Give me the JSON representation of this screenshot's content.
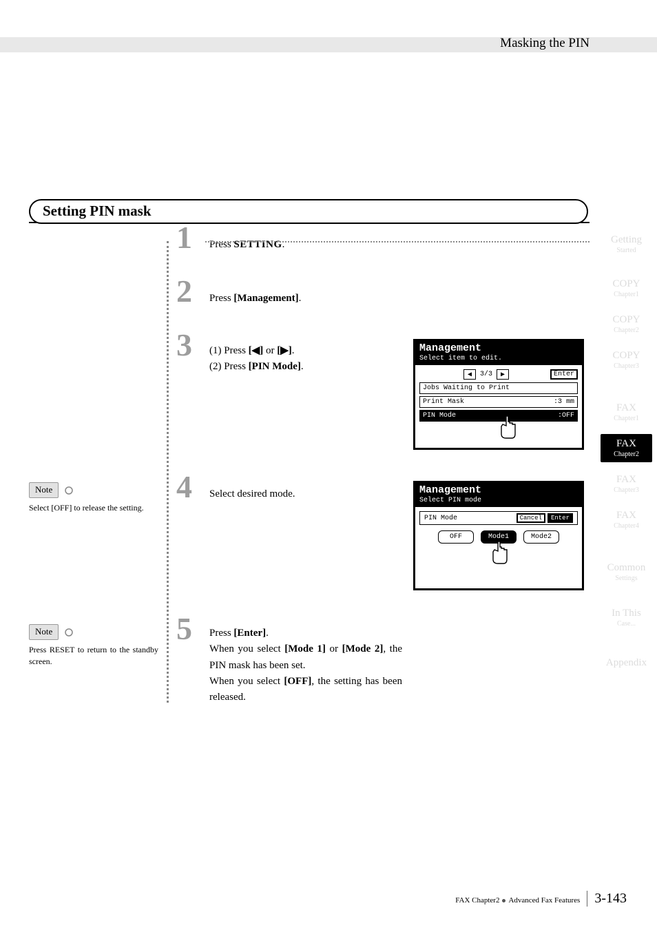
{
  "header": {
    "title": "Masking the PIN"
  },
  "section_title": "Setting PIN mask",
  "sidebar": [
    {
      "label": "Getting",
      "sub": "Started",
      "cls": "sb-fade"
    },
    {
      "label": "COPY",
      "sub": "Chapter1",
      "cls": "sb-fade"
    },
    {
      "label": "COPY",
      "sub": "Chapter2",
      "cls": "sb-fade"
    },
    {
      "label": "COPY",
      "sub": "Chapter3",
      "cls": "sb-fade"
    },
    {
      "label": "FAX",
      "sub": "Chapter1",
      "cls": "sb-fade"
    },
    {
      "label": "FAX",
      "sub": "Chapter2",
      "cls": "sb-active"
    },
    {
      "label": "FAX",
      "sub": "Chapter3",
      "cls": "sb-fade"
    },
    {
      "label": "FAX",
      "sub": "Chapter4",
      "cls": "sb-fade"
    },
    {
      "label": "Common",
      "sub": "Settings",
      "cls": "sb-fade"
    },
    {
      "label": "In This",
      "sub": "Case...",
      "cls": "sb-fade"
    },
    {
      "label": "Appendix",
      "sub": "",
      "cls": "sb-fade"
    }
  ],
  "steps": {
    "s1": {
      "num": "1",
      "pre": "Press ",
      "btn": "SETTING",
      "post": "."
    },
    "s2": {
      "num": "2",
      "pre": "Press ",
      "btn": "[Management]",
      "post": "."
    },
    "s3": {
      "num": "3",
      "l1a": "(1) Press ",
      "l1b": "[◀]",
      "l1c": " or ",
      "l1d": "[▶]",
      "l1e": ".",
      "l2a": "(2) Press ",
      "l2b": "[PIN Mode]",
      "l2c": "."
    },
    "s4": {
      "num": "4",
      "txt": "Select desired mode."
    },
    "s5": {
      "num": "5",
      "line1a": "Press ",
      "line1b": "[Enter]",
      "line1c": ".",
      "line2a": "When you select ",
      "line2b": "[Mode 1]",
      "line2c": " or ",
      "line3a": "[Mode 2]",
      "line3b": ", the PIN mask has been set.",
      "line4a": "When you select ",
      "line4b": "[OFF]",
      "line4c": ", the setting has been released."
    }
  },
  "notes": {
    "n4": {
      "tag": "Note",
      "body_a": "Select ",
      "body_b": "[OFF]",
      "body_c": " to release the setting."
    },
    "n5": {
      "tag": "Note",
      "body_a": "Press ",
      "body_b": "RESET",
      "body_c": " to return to the standby screen."
    }
  },
  "lcd1": {
    "title": "Management",
    "sub": "Select item to edit.",
    "page": "3/3",
    "enter": "Enter",
    "items": [
      {
        "label": "Jobs Waiting to Print",
        "val": ""
      },
      {
        "label": "Print Mask",
        "val": ":3 mm"
      },
      {
        "label": "PIN Mode",
        "val": ":OFF",
        "sel": true
      }
    ]
  },
  "lcd2": {
    "title": "Management",
    "sub": "Select PIN mode",
    "pin": "PIN Mode",
    "cancel": "Cancel",
    "enter": "Enter",
    "opts": [
      "OFF",
      "Mode1",
      "Mode2"
    ]
  },
  "footer": {
    "chapter": "FAX Chapter2",
    "section": "Advanced Fax Features",
    "page": "3-143"
  }
}
